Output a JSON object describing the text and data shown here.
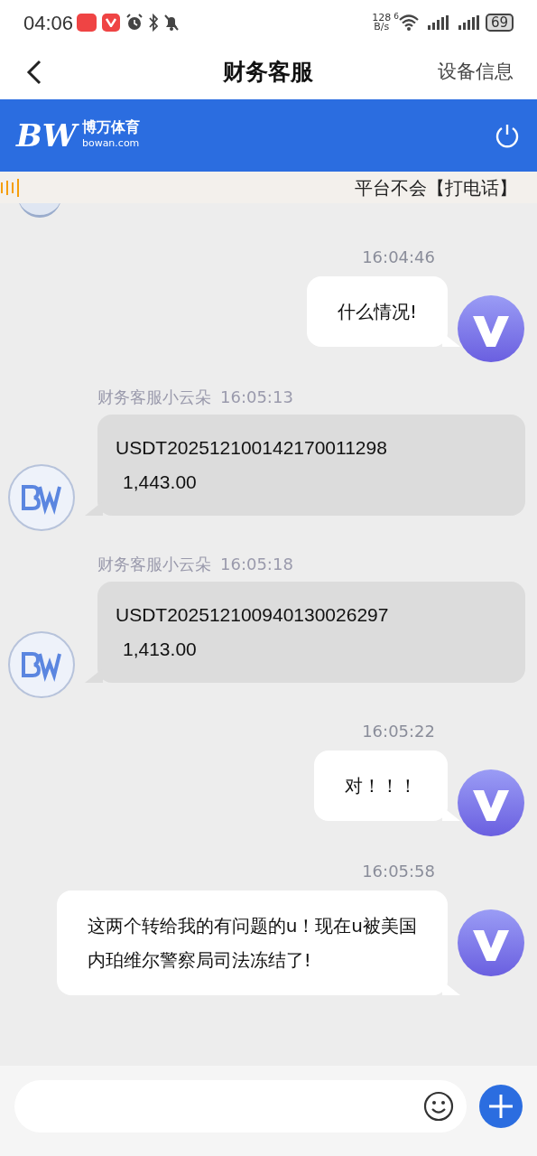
{
  "status_bar": {
    "time": "04:06",
    "net_speed": "128",
    "net_unit": "B/s",
    "wifi_badge": "6",
    "battery": "69"
  },
  "nav": {
    "title": "财务客服",
    "action": "设备信息"
  },
  "brand": {
    "mark": "BW",
    "name": "博万体育",
    "domain": "bowan.com"
  },
  "notice": "平台不会【打电话】",
  "messages": [
    {
      "kind": "sent",
      "time": "16:04:46",
      "lines": [
        "什么情况!"
      ]
    },
    {
      "kind": "received",
      "sender": "财务客服小云朵",
      "time": "16:05:13",
      "lines": [
        "USDT202512100142170011298",
        "1,443.00"
      ]
    },
    {
      "kind": "received",
      "sender": "财务客服小云朵",
      "time": "16:05:18",
      "lines": [
        "USDT202512100940130026297",
        "1,413.00"
      ]
    },
    {
      "kind": "sent",
      "time": "16:05:22",
      "lines": [
        "对！！！"
      ]
    },
    {
      "kind": "sent",
      "time": "16:05:58",
      "lines": [
        "这两个转给我的有问题的u！现在u被美国",
        "内珀维尔警察局司法冻结了!"
      ]
    }
  ]
}
